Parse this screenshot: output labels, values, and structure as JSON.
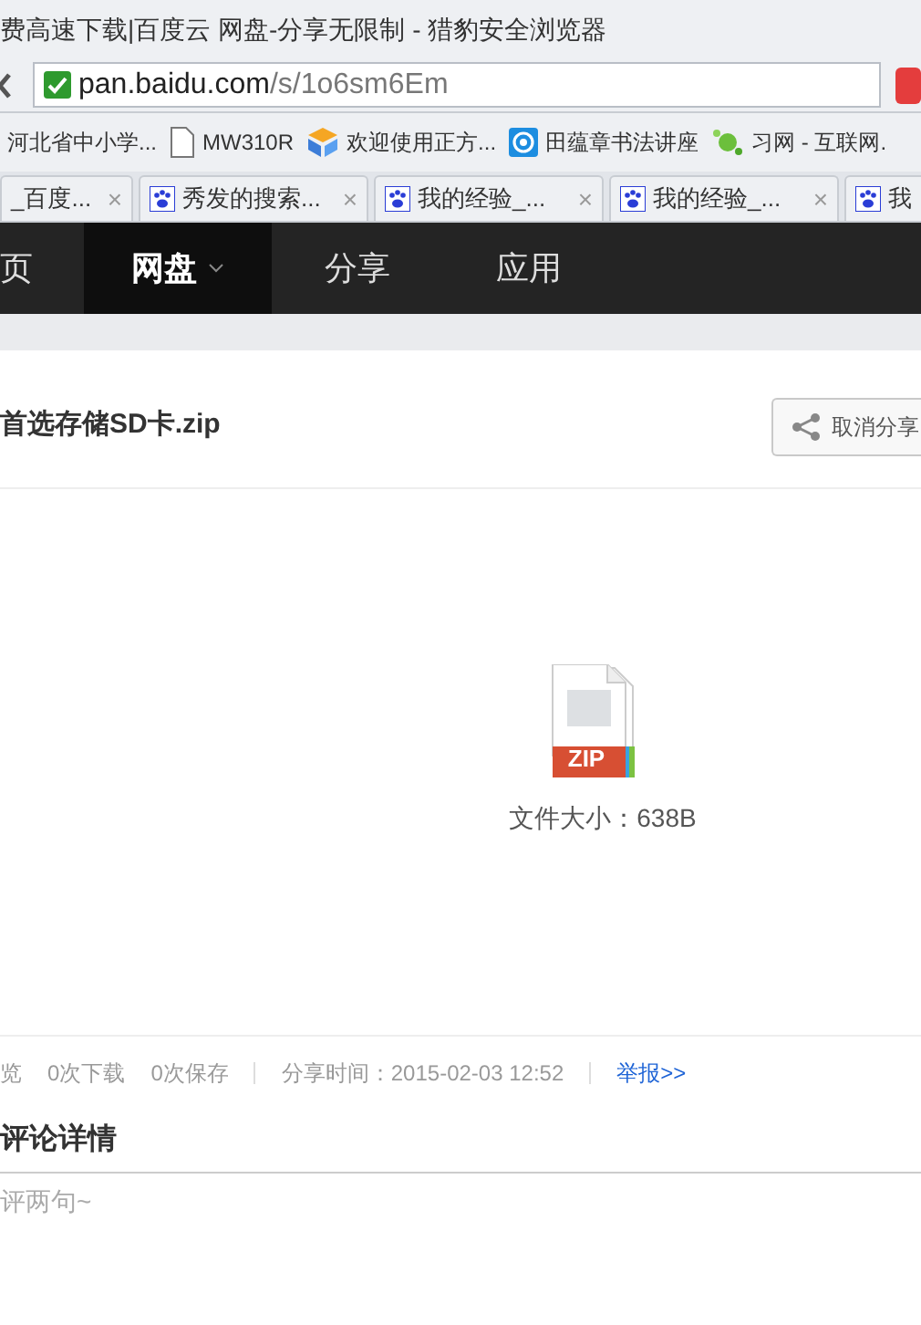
{
  "window": {
    "title": "费高速下载|百度云 网盘-分享无限制 - 猎豹安全浏览器"
  },
  "address_bar": {
    "domain": "pan.baidu.com",
    "path": "/s/1o6sm6Em",
    "secure": true
  },
  "bookmarks": [
    {
      "label": "河北省中小学...",
      "kind": "plain"
    },
    {
      "label": "MW310R",
      "kind": "page"
    },
    {
      "label": "欢迎使用正方...",
      "kind": "cube"
    },
    {
      "label": "田蕴章书法讲座",
      "kind": "target"
    },
    {
      "label": "习网 - 互联网.",
      "kind": "leaf"
    }
  ],
  "tabs": [
    {
      "label": "_百度...",
      "kind": "cut",
      "close": "×"
    },
    {
      "label": "秀发的搜索...",
      "kind": "paw",
      "close": "×"
    },
    {
      "label": "我的经验_...",
      "kind": "paw",
      "close": "×"
    },
    {
      "label": "我的经验_...",
      "kind": "paw",
      "close": "×"
    },
    {
      "label": "我",
      "kind": "paw"
    }
  ],
  "nav": [
    {
      "label": "页",
      "selected": false,
      "dropdown": false
    },
    {
      "label": "网盘",
      "selected": true,
      "dropdown": true
    },
    {
      "label": "分享",
      "selected": false,
      "dropdown": false
    },
    {
      "label": "应用",
      "selected": false,
      "dropdown": false
    }
  ],
  "file": {
    "name": "首选存储SD卡.zip",
    "unshare_button": "取消分享",
    "type_label": "ZIP",
    "size": "文件大小：638B"
  },
  "stats": [
    {
      "text": "览",
      "kind": "plain",
      "separated": false
    },
    {
      "text": "0次下载",
      "kind": "plain",
      "separated": false
    },
    {
      "text": "0次保存",
      "kind": "plain",
      "separated": false
    },
    {
      "text": "分享时间：2015-02-03 12:52",
      "kind": "plain",
      "separated": true
    },
    {
      "text": "举报>>",
      "kind": "link",
      "separated": true
    }
  ],
  "comments": {
    "heading": "评论详情",
    "placeholder": "评两句~"
  }
}
